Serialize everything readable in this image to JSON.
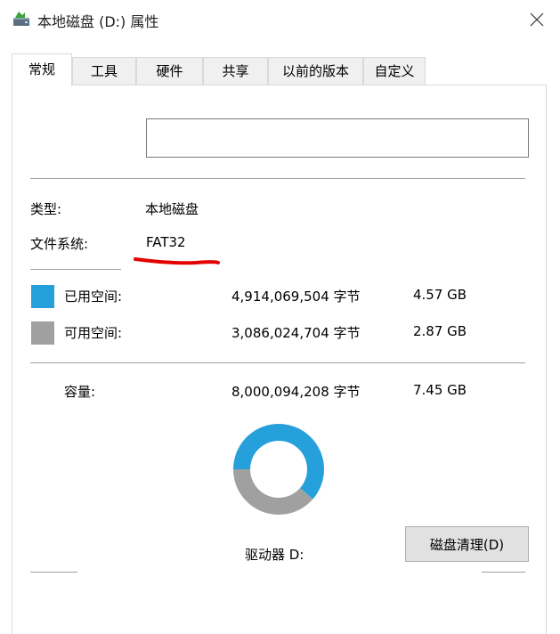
{
  "window": {
    "title": "本地磁盘 (D:) 属性",
    "icon": "drive-icon",
    "close_glyph": "✕"
  },
  "tabs": [
    {
      "label": "常规",
      "active": true
    },
    {
      "label": "工具",
      "active": false
    },
    {
      "label": "硬件",
      "active": false
    },
    {
      "label": "共享",
      "active": false
    },
    {
      "label": "以前的版本",
      "active": false
    },
    {
      "label": "自定义",
      "active": false
    }
  ],
  "general": {
    "volume_name_value": "",
    "type_label": "类型:",
    "type_value": "本地磁盘",
    "fs_label": "文件系统:",
    "fs_value": "FAT32",
    "used": {
      "label": "已用空间:",
      "bytes": "4,914,069,504 字节",
      "size": "4.57 GB",
      "color": "#26a0da"
    },
    "free": {
      "label": "可用空间:",
      "bytes": "3,086,024,704 字节",
      "size": "2.87 GB",
      "color": "#a0a0a0"
    },
    "capacity": {
      "label": "容量:",
      "bytes": "8,000,094,208 字节",
      "size": "7.45 GB"
    },
    "drive_label": "驱动器 D:",
    "cleanup_label": "磁盘清理(D)",
    "used_fraction": 0.6143,
    "annotation_color": "#e30000"
  }
}
